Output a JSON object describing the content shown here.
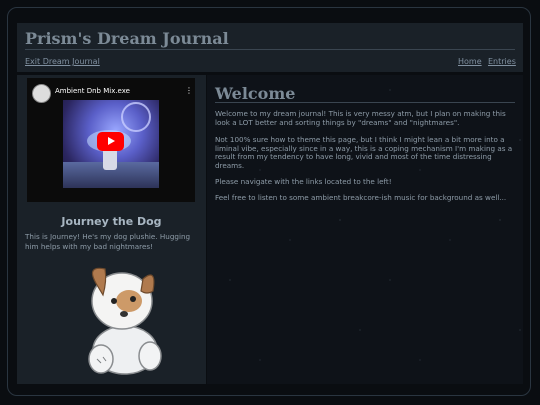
{
  "header": {
    "title": "Prism's Dream Journal",
    "exit_link": "Exit Dream Journal",
    "nav": [
      "Home",
      "Entries"
    ]
  },
  "video": {
    "title": "Ambient Dnb Mix.exe",
    "menu_icon": "more-vert-icon",
    "play_icon": "youtube-play-icon"
  },
  "sidebar": {
    "heading": "Journey the Dog",
    "text": "This is Journey! He's my dog plushie. Hugging him helps with my bad nightmares!"
  },
  "main": {
    "title": "Welcome",
    "paragraphs": [
      "Welcome to my dream journal! This is very messy atm, but I plan on making this look a LOT better and sorting things by \"dreams\" and \"nightmares\".",
      "Not 100% sure how to theme this page, but I think I might lean a bit more into a liminal vibe, especially since in a way, this is a coping mechanism I'm making as a result from my tendency to have long, vivid and most of the time distressing dreams.",
      "Please navigate with the links located to the left!",
      "Feel free to listen to some ambient breakcore-ish music for background as well..."
    ]
  }
}
